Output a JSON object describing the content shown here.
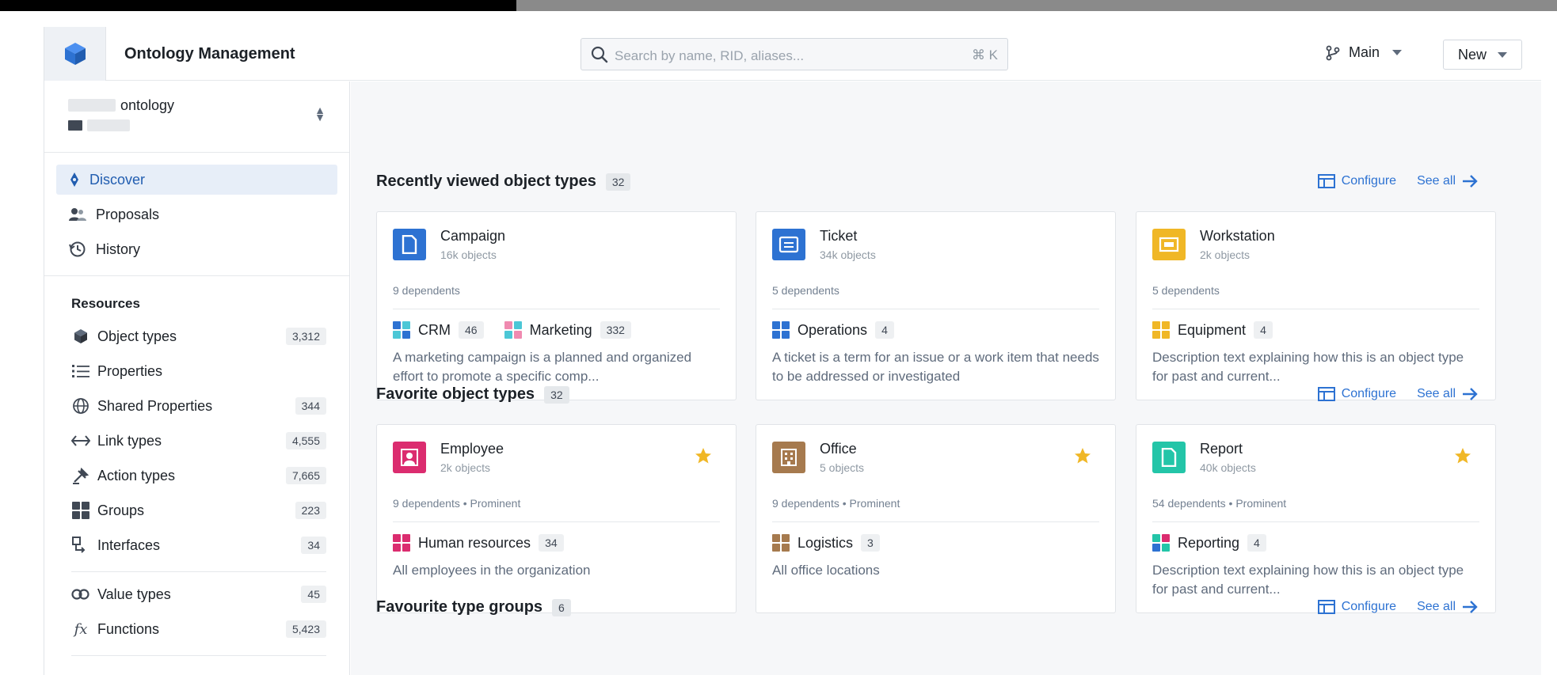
{
  "header": {
    "app_title": "Ontology Management",
    "search_placeholder": "Search by name, RID, aliases...",
    "search_shortcut": "⌘ K",
    "branch": "Main",
    "new_label": "New"
  },
  "sidebar": {
    "ontology_name": "ontology",
    "nav": [
      {
        "label": "Discover",
        "icon": "discover-icon",
        "active": true
      },
      {
        "label": "Proposals",
        "icon": "proposals-icon"
      },
      {
        "label": "History",
        "icon": "history-icon"
      }
    ],
    "resources_title": "Resources",
    "resources": [
      {
        "label": "Object types",
        "count": "3,312",
        "icon": "cube-icon"
      },
      {
        "label": "Properties",
        "count": "",
        "icon": "list-icon"
      },
      {
        "label": "Shared Properties",
        "count": "344",
        "icon": "globe-icon"
      },
      {
        "label": "Link types",
        "count": "4,555",
        "icon": "link-arrows-icon"
      },
      {
        "label": "Action types",
        "count": "7,665",
        "icon": "action-icon"
      },
      {
        "label": "Groups",
        "count": "223",
        "icon": "groups-icon"
      },
      {
        "label": "Interfaces",
        "count": "34",
        "icon": "interface-icon"
      },
      {
        "label": "Value types",
        "count": "45",
        "icon": "value-types-icon"
      },
      {
        "label": "Functions",
        "count": "5,423",
        "icon": "function-icon"
      }
    ]
  },
  "sections": [
    {
      "title": "Recently viewed object types",
      "count": "32",
      "configure": "Configure",
      "see_all": "See all",
      "cards": [
        {
          "name": "Campaign",
          "objects": "16k objects",
          "dependents": "9 dependents",
          "color": "#2d72d2",
          "groups": [
            {
              "label": "CRM",
              "count": "46"
            },
            {
              "label": "Marketing",
              "count": "332"
            }
          ],
          "description": "A marketing campaign is a planned and organized effort to promote a specific comp..."
        },
        {
          "name": "Ticket",
          "objects": "34k objects",
          "dependents": "5 dependents",
          "color": "#2d72d2",
          "groups": [
            {
              "label": "Operations",
              "count": "4"
            }
          ],
          "description": "A ticket is a term for an issue or a work item that needs to be addressed or investigated"
        },
        {
          "name": "Workstation",
          "objects": "2k objects",
          "dependents": "5 dependents",
          "color": "#f0b726",
          "groups": [
            {
              "label": "Equipment",
              "count": "4"
            }
          ],
          "description": "Description text explaining how this is an object type for past and current..."
        }
      ]
    },
    {
      "title": "Favorite object types",
      "count": "32",
      "configure": "Configure",
      "see_all": "See all",
      "cards": [
        {
          "name": "Employee",
          "objects": "2k objects",
          "dependents": "9 dependents",
          "prominent": "Prominent",
          "color": "#db2c6f",
          "groups": [
            {
              "label": "Human resources",
              "count": "34"
            }
          ],
          "description": "All employees in the organization"
        },
        {
          "name": "Office",
          "objects": "5 objects",
          "dependents": "9 dependents",
          "prominent": "Prominent",
          "color": "#a67a4e",
          "groups": [
            {
              "label": "Logistics",
              "count": "3"
            }
          ],
          "description": "All office locations"
        },
        {
          "name": "Report",
          "objects": "40k objects",
          "dependents": "54 dependents",
          "prominent": "Prominent",
          "color": "#23c5a8",
          "groups": [
            {
              "label": "Reporting",
              "count": "4"
            }
          ],
          "description": "Description text explaining how this is an object type for past and current..."
        }
      ]
    },
    {
      "title": "Favourite type groups",
      "count": "6",
      "configure": "Configure",
      "see_all": "See all"
    }
  ]
}
